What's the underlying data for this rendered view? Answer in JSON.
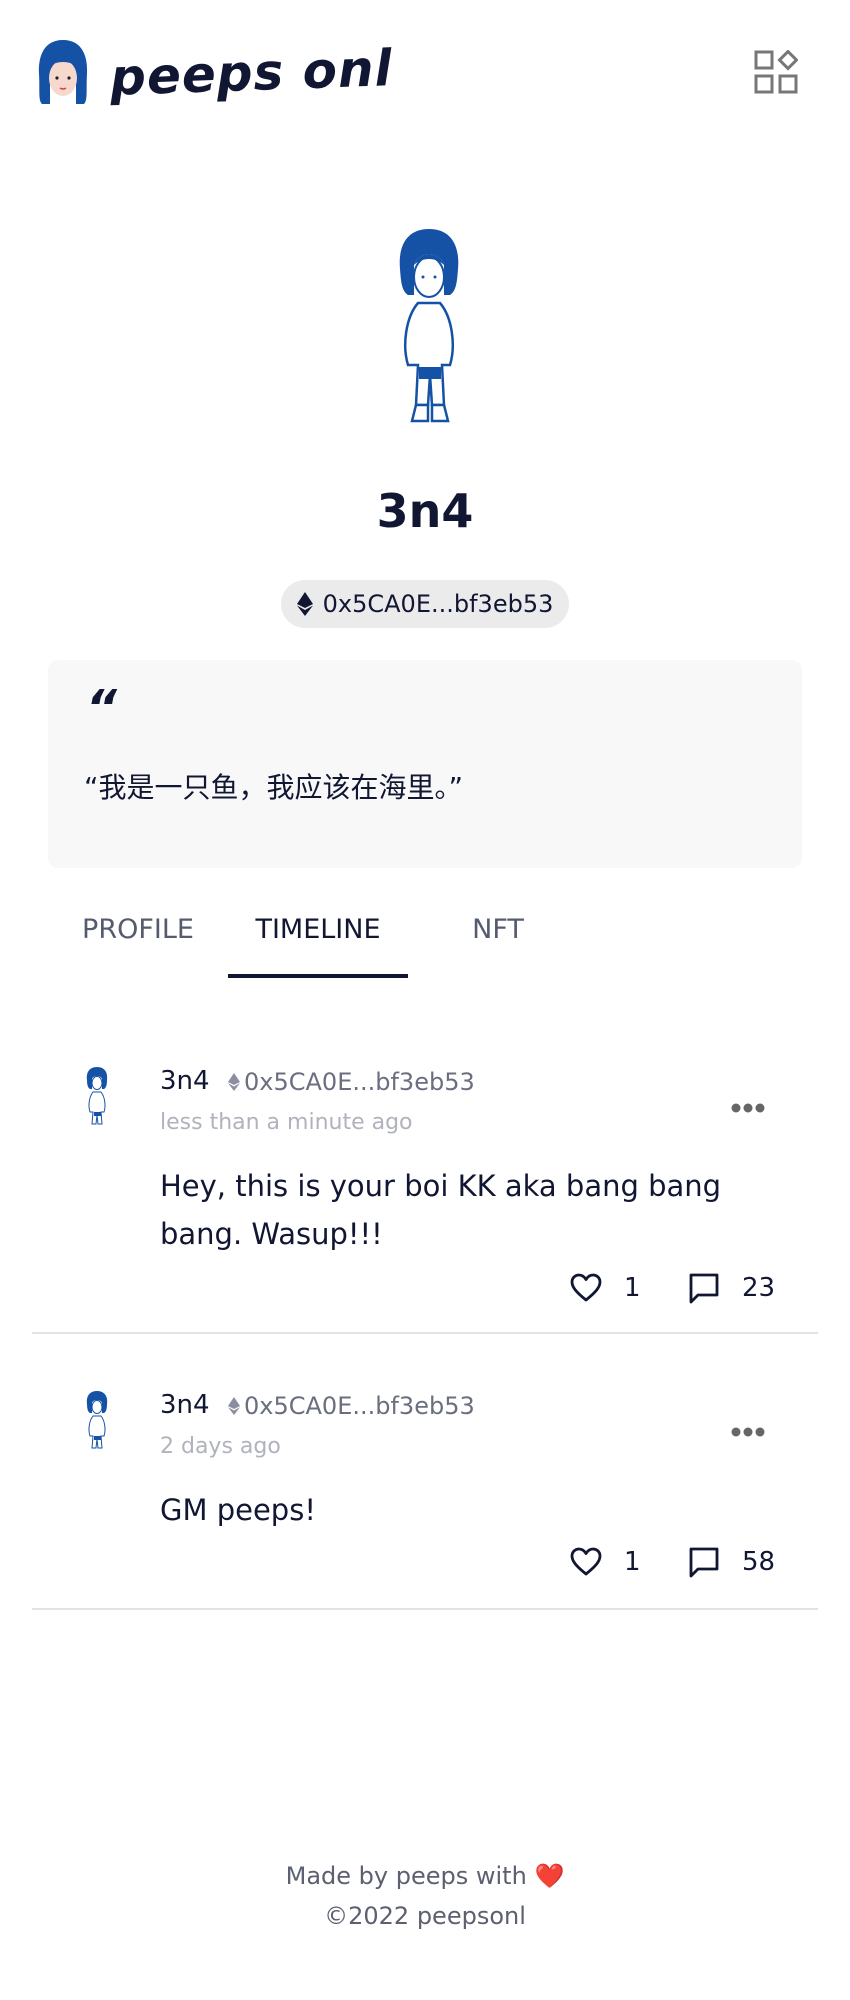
{
  "header": {
    "brand": "peeps onl",
    "menu_icon": "apps-grid-icon"
  },
  "profile": {
    "username": "3n4",
    "address": "0x5CA0E...bf3eb53",
    "quote_mark": "“",
    "bio": "“我是一只鱼，我应该在海里。”"
  },
  "tabs": [
    {
      "label": "PROFILE",
      "active": false
    },
    {
      "label": "TIMELINE",
      "active": true
    },
    {
      "label": "NFT",
      "active": false
    }
  ],
  "posts": [
    {
      "author": "3n4",
      "address": "0x5CA0E...bf3eb53",
      "time": "less than a minute ago",
      "body": "Hey, this is your boi KK aka bang bang bang. Wasup!!!",
      "likes": "1",
      "comments": "23"
    },
    {
      "author": "3n4",
      "address": "0x5CA0E...bf3eb53",
      "time": "2 days ago",
      "body": "GM peeps!",
      "likes": "1",
      "comments": "58"
    }
  ],
  "footer": {
    "made_by": "Made by peeps with",
    "heart": "❤️",
    "copyright": "©2022 peepsonl"
  },
  "colors": {
    "text": "#111633",
    "avatar_blue": "#1552a6",
    "pill_bg": "#ebebeb",
    "card_bg": "#f8f8f8"
  }
}
